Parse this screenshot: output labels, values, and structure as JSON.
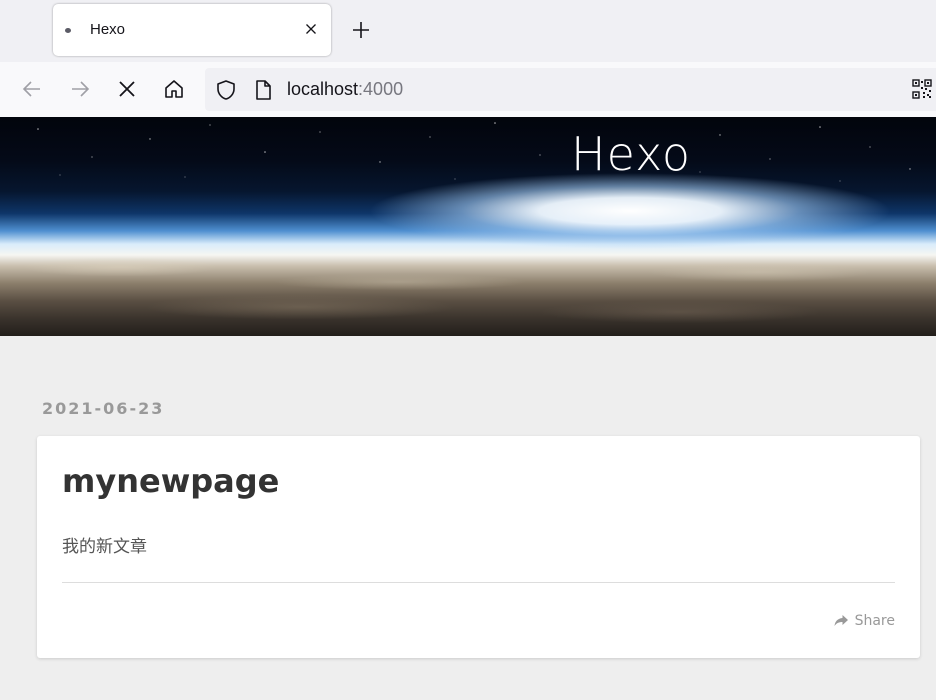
{
  "browser": {
    "tab": {
      "title": "Hexo"
    },
    "url": {
      "host": "localhost",
      "port": ":4000"
    }
  },
  "site": {
    "banner_title": "Hexo"
  },
  "post": {
    "date": "2021-06-23",
    "title": "mynewpage",
    "body": "我的新文章",
    "share_label": "Share"
  },
  "colors": {
    "page_bg": "#eeeeee",
    "card_bg": "#ffffff",
    "muted_text": "#999999",
    "title_text": "#333333"
  }
}
